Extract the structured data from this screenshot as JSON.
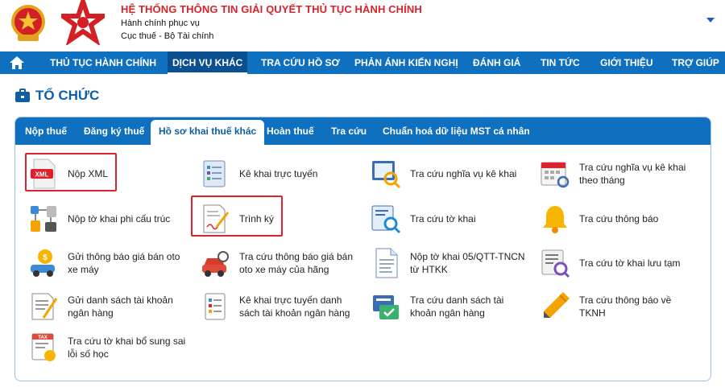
{
  "header": {
    "title": "HỆ THỐNG THÔNG TIN GIẢI QUYẾT THỦ TỤC HÀNH CHÍNH",
    "subtitle1": "Hành chính phục vụ",
    "subtitle2": "Cục thuế - Bộ Tài chính"
  },
  "nav": {
    "items": [
      {
        "label": "THỦ TỤC HÀNH CHÍNH"
      },
      {
        "label": "DỊCH VỤ KHÁC"
      },
      {
        "label": "TRA CỨU HỒ SƠ"
      },
      {
        "label": "PHẢN ÁNH KIẾN NGHỊ"
      },
      {
        "label": "ĐÁNH GIÁ"
      },
      {
        "label": "TIN TỨC"
      },
      {
        "label": "GIỚI THIỆU"
      },
      {
        "label": "TRỢ GIÚP"
      }
    ]
  },
  "section": {
    "title": "TỔ CHỨC"
  },
  "tabs": [
    {
      "label": "Nộp thuế"
    },
    {
      "label": "Đăng ký thuế"
    },
    {
      "label": "Hồ sơ khai thuế khác"
    },
    {
      "label": "Hoàn thuế"
    },
    {
      "label": "Tra cứu"
    },
    {
      "label": "Chuẩn hoá dữ liệu MST cá nhân"
    }
  ],
  "services": [
    {
      "label": "Nộp XML",
      "icon": "xml-file-icon"
    },
    {
      "label": "Kê khai trực tuyến",
      "icon": "online-declaration-icon"
    },
    {
      "label": "Tra cứu nghĩa vụ kê khai",
      "icon": "obligation-lookup-icon"
    },
    {
      "label": "Tra cứu nghĩa vụ kê khai theo tháng",
      "icon": "monthly-calendar-icon"
    },
    {
      "label": "Nộp tờ khai phi cấu trúc",
      "icon": "unstructured-form-icon"
    },
    {
      "label": "Trình ký",
      "icon": "sign-document-icon"
    },
    {
      "label": "Tra cứu tờ khai",
      "icon": "form-lookup-icon"
    },
    {
      "label": "Tra cứu thông báo",
      "icon": "bell-icon"
    },
    {
      "label": "Gửi thông báo giá bán oto xe máy",
      "icon": "vehicle-price-icon"
    },
    {
      "label": "Tra cứu thông báo giá bán oto xe máy của hãng",
      "icon": "car-lookup-icon"
    },
    {
      "label": "Nộp tờ khai 05/QTT-TNCN từ HTKK",
      "icon": "document-icon"
    },
    {
      "label": "Tra cứu tờ khai lưu tạm",
      "icon": "draft-lookup-icon"
    },
    {
      "label": "Gửi danh sách tài khoản ngân hàng",
      "icon": "bank-list-icon"
    },
    {
      "label": "Kê khai trực tuyến danh sách tài khoản ngân hàng",
      "icon": "bank-declaration-icon"
    },
    {
      "label": "Tra cứu danh sách tài khoản ngân hàng",
      "icon": "bank-lookup-icon"
    },
    {
      "label": "Tra cứu thông báo về TKNH",
      "icon": "pencil-icon"
    },
    {
      "label": "Tra cứu tờ khai bổ sung sai lỗi số học",
      "icon": "tax-form-icon"
    }
  ],
  "colors": {
    "primary": "#0f70c0",
    "highlight": "#e0202a",
    "title": "#d8232a"
  }
}
